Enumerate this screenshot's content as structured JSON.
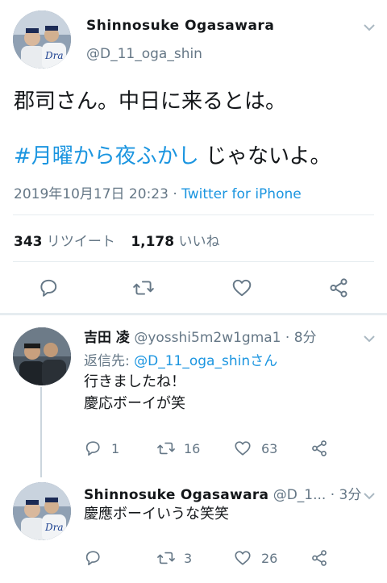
{
  "main_tweet": {
    "display_name": "Shinnosuke  Ogasawara",
    "handle": "@D_11_oga_shin",
    "text_line1": "郡司さん。中日に来るとは。",
    "hashtag": "#月曜から夜ふかし",
    "text_line2_rest": " じゃないよ。",
    "timestamp": "2019年10月17日 20:23",
    "separator": " · ",
    "source": "Twitter for iPhone",
    "retweet_count": "343",
    "retweet_label": "リツイート",
    "like_count": "1,178",
    "like_label": "いいね"
  },
  "replies": [
    {
      "display_name": "吉田 凌",
      "handle": "@yosshi5m2w1gma1",
      "time": " · 8分",
      "reply_to_prefix": "返信先: ",
      "reply_to_handle": "@D_11_oga_shinさん",
      "text_line1": "行きましたね！",
      "text_line2": "慶応ボーイが笑",
      "reply_count": "1",
      "retweet_count": "16",
      "like_count": "63"
    },
    {
      "display_name": "Shinnosuke  Ogasawara",
      "handle": "@D_1...",
      "time": " · 3分",
      "text_line1": "慶應ボーイいうな笑笑",
      "retweet_count": "3",
      "like_count": "26"
    }
  ],
  "icons": {
    "reply": "reply-icon",
    "retweet": "retweet-icon",
    "like": "heart-icon",
    "share": "share-icon",
    "caret": "chevron-down-icon"
  },
  "colors": {
    "link": "#1b95e0",
    "secondary": "#657786",
    "divider": "#e6ecf0"
  }
}
